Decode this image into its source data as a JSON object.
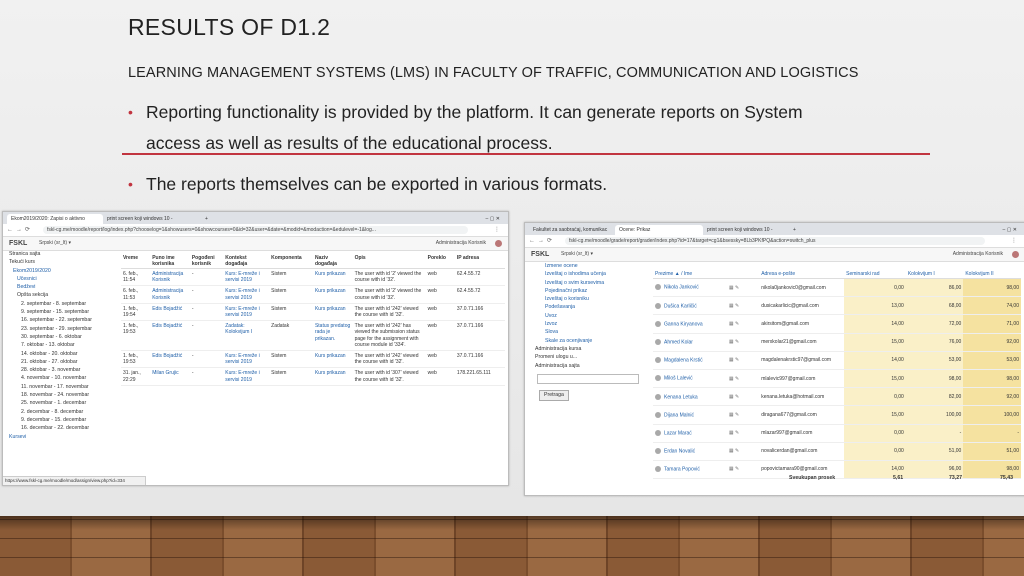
{
  "slide": {
    "title": "RESULTS OF D1.2",
    "subtitle": "LEARNING MANAGEMENT SYSTEMS (LMS) IN FACULTY OF TRAFFIC, COMMUNICATION AND LOGISTICS",
    "bullet1_line1": "Reporting functionality  is provided by the platform. It can generate reports on System",
    "bullet1_line2": "access as well as results of the educational process.",
    "bullet2": "The reports themselves can be exported in various formats.",
    "bullet_glyph": "•"
  },
  "left_window": {
    "tab1": "Ekom2019/2020: Zapisi o aktivno",
    "tab2": "print screen koji windows 10 - ",
    "url": "fskl-cg.me/moodle/report/log/index.php?chooselog=1&showusers=0&showcourses=0&id=32&user=&date=&modid=&modaction=&edulevel=-1&log...",
    "brand": "FSKL",
    "lang": "Srpski (sr_lt) ▾",
    "user": "Administracija Korisnik",
    "sidebar": [
      "Stranica sajta",
      "Tekući kurs",
      "Ekom2019/2020",
      "Učesnici",
      "Bedževi",
      "Opšta sekcija",
      "2. septembar - 8. septembar",
      "9. septembar - 15. septembar",
      "16. septembar - 22. septembar",
      "23. septembar - 29. septembar",
      "30. septembar - 6. oktobar",
      "7. oktobar - 13. oktobar",
      "14. oktobar - 20. oktobar",
      "21. oktobar - 27. oktobar",
      "28. oktobar - 3. novembar",
      "4. novembar - 10. novembar",
      "11. novembar - 17. novembar",
      "18. novembar - 24. novembar",
      "25. novembar - 1. decembar",
      "2. decembar - 8. decembar",
      "9. decembar - 15. decembar",
      "16. decembar - 22. decembar",
      "Kursevi"
    ],
    "headers": [
      "Vreme",
      "Puno ime korisnika",
      "Pogođeni korisnik",
      "Kontekst događaja",
      "Komponenta",
      "Naziv događaja",
      "Opis",
      "Poreklo",
      "IP adresa"
    ],
    "rows": [
      [
        "6. feb., 11:54",
        "Administracija Korisnik",
        "-",
        "Kurs: E-mrežе i servisi 2019",
        "Sistem",
        "Kurs prikazan",
        "The user with id '2' viewed the course with id '32'.",
        "web",
        "62.4.55.72"
      ],
      [
        "6. feb., 11:53",
        "Administracija Korisnik",
        "-",
        "Kurs: E-mrežе i servisi 2019",
        "Sistem",
        "Kurs prikazan",
        "The user with id '2' viewed the course with id '32'.",
        "web",
        "62.4.55.72"
      ],
      [
        "1. feb., 19:54",
        "Edis Bojadžić",
        "-",
        "Kurs: E-mrežе i servisi 2019",
        "Sistem",
        "Kurs prikazan",
        "The user with id '242' viewed the course with id '32'.",
        "web",
        "37.0.71.166"
      ],
      [
        "1. feb., 19:53",
        "Edis Bojadžić",
        "-",
        "Zadatak: Kolokvijum I",
        "Zadatak",
        "Status predatog rada je prikazan.",
        "The user with id '242' has viewed the submission status page for the assignment with course module id '334'.",
        "web",
        "37.0.71.166"
      ],
      [
        "1. feb., 19:53",
        "Edis Bojadžić",
        "-",
        "Kurs: E-mrežе i servisi 2019",
        "Sistem",
        "Kurs prikazan",
        "The user with id '242' viewed the course with id '32'.",
        "web",
        "37.0.71.166"
      ],
      [
        "31. jan., 22:29",
        "Milan Grujic",
        "-",
        "Kurs: E-mrežе i servisi 2019",
        "Sistem",
        "Kurs prikazan",
        "The user with id '307' viewed the course with id '32'.",
        "web",
        "178.221.65.111"
      ]
    ],
    "status_url": "https://www.fskl-cg.me/moodle/mod/assign/view.php?id=334"
  },
  "right_window": {
    "tab1": "Fakultet za saobraćaj, komunikac",
    "tab2": "Ocene: Prikaz",
    "tab3": "print screen koji windows 10 - ",
    "url": "fskl-cg.me/moodle/grade/report/grader/index.php?id=17&target=cg1&bsessky=8Lb3PKfPQ&action=switch_plus",
    "brand": "FSKL",
    "lang": "Srpski (sr_lt) ▾",
    "user": "Administracija Korisnik",
    "sidebar": [
      "Izmene ocene",
      "Izveštaj o ishodima učenja",
      "Izveštaj o svim kursevima",
      "Pojedinačni prikaz",
      "Izveštaj o korisniku",
      "Podešavanja",
      "Uvoz",
      "Izvoz",
      "Slova",
      "Skale za ocenjivanje",
      "Administracija kursa",
      "Promeni ulogu u...",
      "Administracija sajta"
    ],
    "search_button": "Pretraga",
    "headers": [
      "Prezime ▲ / Ime",
      "",
      "Adresa e-pošte",
      "Seminarski rad",
      "Kolokvijum I",
      "Kolokvijum II"
    ],
    "rows": [
      [
        "Nikola Janković",
        "nikola0jankovic0@gmail.com",
        "0,00",
        "86,00",
        "98,00"
      ],
      [
        "Dušica Karličić",
        "dusicakarlicic@gmail.com",
        "13,00",
        "68,00",
        "74,00"
      ],
      [
        "Ganna Kiryanova",
        "akirsitom@gmail.com",
        "14,00",
        "72,00",
        "71,00"
      ],
      [
        "Ahmed Kolar",
        "merxkolar21@gmail.com",
        "15,00",
        "76,00",
        "92,00"
      ],
      [
        "Magdalena Krstić",
        "magdalenakrstic97@gmail.com",
        "14,00",
        "53,00",
        "53,00"
      ],
      [
        "Miloš Lalević",
        "mlalevic997@gmail.com",
        "15,00",
        "98,00",
        "98,00"
      ],
      [
        "Kenana Letuka",
        "kenana.letuka@hotmail.com",
        "0,00",
        "82,00",
        "92,00"
      ],
      [
        "Dijana Malnić",
        "diragana677@gmail.com",
        "15,00",
        "100,00",
        "100,00"
      ],
      [
        "Lazar Marać",
        "mlazar997@gmail.com",
        "0,00",
        "-",
        "-"
      ],
      [
        "Erdan Novalić",
        "novalicerdan@gmail.com",
        "0,00",
        "51,00",
        "51,00"
      ],
      [
        "Tamara Popović",
        "popovictamara90@gmail.com",
        "14,00",
        "96,00",
        "98,00"
      ]
    ],
    "total_label": "Sveukupan prosek",
    "totals": [
      "5,61",
      "73,27",
      "75,43"
    ]
  }
}
